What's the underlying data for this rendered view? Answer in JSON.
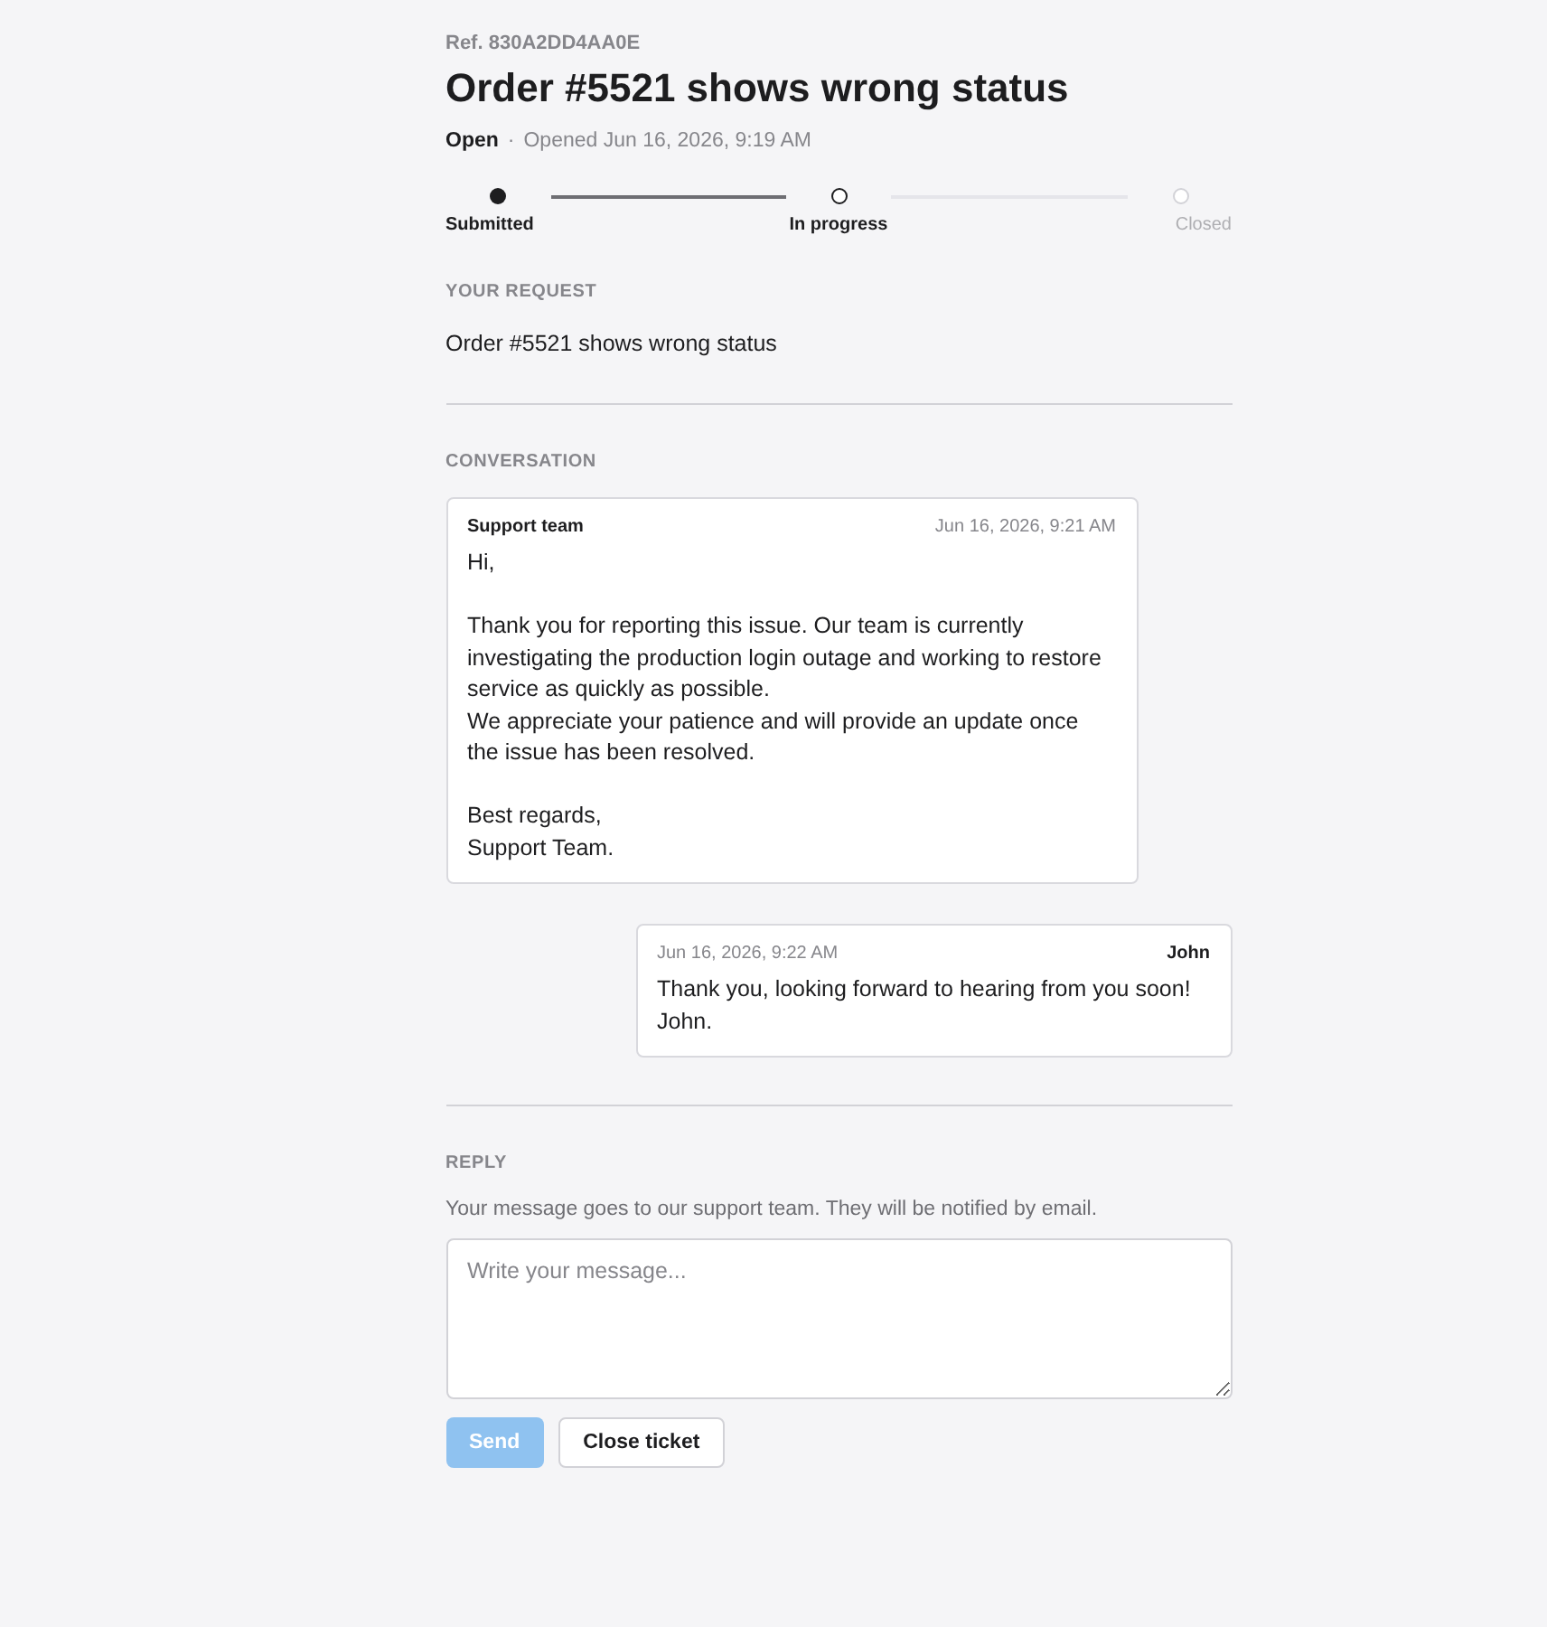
{
  "ticket": {
    "ref": "Ref. 830A2DD4AA0E",
    "title": "Order #5521 shows wrong status",
    "status": "Open",
    "separator": "·",
    "opened": "Opened Jun 16, 2026, 9:19 AM"
  },
  "steps": [
    {
      "label": "Submitted",
      "kind": "done"
    },
    {
      "label": "In progress",
      "kind": "current"
    },
    {
      "label": "Closed",
      "kind": "upcoming"
    }
  ],
  "request": {
    "heading": "YOUR REQUEST",
    "text": "Order #5521 shows wrong status"
  },
  "conversation": {
    "heading": "CONVERSATION",
    "messages": [
      {
        "kind": "agent",
        "author": "Support team",
        "time": "Jun 16, 2026, 9:21 AM",
        "body": "Hi,\n\nThank you for reporting this issue. Our team is currently investigating the production login outage and working to restore service as quickly as possible.\nWe appreciate your patience and will provide an update once the issue has been resolved.\n\nBest regards,\nSupport Team."
      },
      {
        "kind": "customer",
        "author": "John",
        "time": "Jun 16, 2026, 9:22 AM",
        "body": "Thank you, looking forward to hearing from you soon!\nJohn."
      }
    ]
  },
  "reply": {
    "heading": "REPLY",
    "hint": "Your message goes to our support team. They will be notified by email.",
    "placeholder": "Write your message...",
    "buttons": [
      {
        "kind": "primary",
        "label": "Send",
        "disabled": true
      },
      {
        "kind": "secondary",
        "label": "Close ticket",
        "disabled": false
      }
    ]
  }
}
